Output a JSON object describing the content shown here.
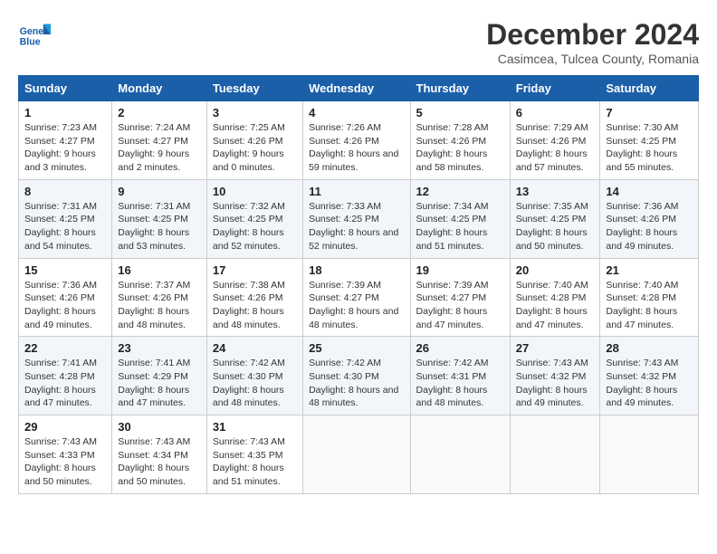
{
  "header": {
    "logo_line1": "General",
    "logo_line2": "Blue",
    "title": "December 2024",
    "subtitle": "Casimcea, Tulcea County, Romania"
  },
  "weekdays": [
    "Sunday",
    "Monday",
    "Tuesday",
    "Wednesday",
    "Thursday",
    "Friday",
    "Saturday"
  ],
  "weeks": [
    [
      {
        "day": "1",
        "sunrise": "Sunrise: 7:23 AM",
        "sunset": "Sunset: 4:27 PM",
        "daylight": "Daylight: 9 hours and 3 minutes."
      },
      {
        "day": "2",
        "sunrise": "Sunrise: 7:24 AM",
        "sunset": "Sunset: 4:27 PM",
        "daylight": "Daylight: 9 hours and 2 minutes."
      },
      {
        "day": "3",
        "sunrise": "Sunrise: 7:25 AM",
        "sunset": "Sunset: 4:26 PM",
        "daylight": "Daylight: 9 hours and 0 minutes."
      },
      {
        "day": "4",
        "sunrise": "Sunrise: 7:26 AM",
        "sunset": "Sunset: 4:26 PM",
        "daylight": "Daylight: 8 hours and 59 minutes."
      },
      {
        "day": "5",
        "sunrise": "Sunrise: 7:28 AM",
        "sunset": "Sunset: 4:26 PM",
        "daylight": "Daylight: 8 hours and 58 minutes."
      },
      {
        "day": "6",
        "sunrise": "Sunrise: 7:29 AM",
        "sunset": "Sunset: 4:26 PM",
        "daylight": "Daylight: 8 hours and 57 minutes."
      },
      {
        "day": "7",
        "sunrise": "Sunrise: 7:30 AM",
        "sunset": "Sunset: 4:25 PM",
        "daylight": "Daylight: 8 hours and 55 minutes."
      }
    ],
    [
      {
        "day": "8",
        "sunrise": "Sunrise: 7:31 AM",
        "sunset": "Sunset: 4:25 PM",
        "daylight": "Daylight: 8 hours and 54 minutes."
      },
      {
        "day": "9",
        "sunrise": "Sunrise: 7:31 AM",
        "sunset": "Sunset: 4:25 PM",
        "daylight": "Daylight: 8 hours and 53 minutes."
      },
      {
        "day": "10",
        "sunrise": "Sunrise: 7:32 AM",
        "sunset": "Sunset: 4:25 PM",
        "daylight": "Daylight: 8 hours and 52 minutes."
      },
      {
        "day": "11",
        "sunrise": "Sunrise: 7:33 AM",
        "sunset": "Sunset: 4:25 PM",
        "daylight": "Daylight: 8 hours and 52 minutes."
      },
      {
        "day": "12",
        "sunrise": "Sunrise: 7:34 AM",
        "sunset": "Sunset: 4:25 PM",
        "daylight": "Daylight: 8 hours and 51 minutes."
      },
      {
        "day": "13",
        "sunrise": "Sunrise: 7:35 AM",
        "sunset": "Sunset: 4:25 PM",
        "daylight": "Daylight: 8 hours and 50 minutes."
      },
      {
        "day": "14",
        "sunrise": "Sunrise: 7:36 AM",
        "sunset": "Sunset: 4:26 PM",
        "daylight": "Daylight: 8 hours and 49 minutes."
      }
    ],
    [
      {
        "day": "15",
        "sunrise": "Sunrise: 7:36 AM",
        "sunset": "Sunset: 4:26 PM",
        "daylight": "Daylight: 8 hours and 49 minutes."
      },
      {
        "day": "16",
        "sunrise": "Sunrise: 7:37 AM",
        "sunset": "Sunset: 4:26 PM",
        "daylight": "Daylight: 8 hours and 48 minutes."
      },
      {
        "day": "17",
        "sunrise": "Sunrise: 7:38 AM",
        "sunset": "Sunset: 4:26 PM",
        "daylight": "Daylight: 8 hours and 48 minutes."
      },
      {
        "day": "18",
        "sunrise": "Sunrise: 7:39 AM",
        "sunset": "Sunset: 4:27 PM",
        "daylight": "Daylight: 8 hours and 48 minutes."
      },
      {
        "day": "19",
        "sunrise": "Sunrise: 7:39 AM",
        "sunset": "Sunset: 4:27 PM",
        "daylight": "Daylight: 8 hours and 47 minutes."
      },
      {
        "day": "20",
        "sunrise": "Sunrise: 7:40 AM",
        "sunset": "Sunset: 4:28 PM",
        "daylight": "Daylight: 8 hours and 47 minutes."
      },
      {
        "day": "21",
        "sunrise": "Sunrise: 7:40 AM",
        "sunset": "Sunset: 4:28 PM",
        "daylight": "Daylight: 8 hours and 47 minutes."
      }
    ],
    [
      {
        "day": "22",
        "sunrise": "Sunrise: 7:41 AM",
        "sunset": "Sunset: 4:28 PM",
        "daylight": "Daylight: 8 hours and 47 minutes."
      },
      {
        "day": "23",
        "sunrise": "Sunrise: 7:41 AM",
        "sunset": "Sunset: 4:29 PM",
        "daylight": "Daylight: 8 hours and 47 minutes."
      },
      {
        "day": "24",
        "sunrise": "Sunrise: 7:42 AM",
        "sunset": "Sunset: 4:30 PM",
        "daylight": "Daylight: 8 hours and 48 minutes."
      },
      {
        "day": "25",
        "sunrise": "Sunrise: 7:42 AM",
        "sunset": "Sunset: 4:30 PM",
        "daylight": "Daylight: 8 hours and 48 minutes."
      },
      {
        "day": "26",
        "sunrise": "Sunrise: 7:42 AM",
        "sunset": "Sunset: 4:31 PM",
        "daylight": "Daylight: 8 hours and 48 minutes."
      },
      {
        "day": "27",
        "sunrise": "Sunrise: 7:43 AM",
        "sunset": "Sunset: 4:32 PM",
        "daylight": "Daylight: 8 hours and 49 minutes."
      },
      {
        "day": "28",
        "sunrise": "Sunrise: 7:43 AM",
        "sunset": "Sunset: 4:32 PM",
        "daylight": "Daylight: 8 hours and 49 minutes."
      }
    ],
    [
      {
        "day": "29",
        "sunrise": "Sunrise: 7:43 AM",
        "sunset": "Sunset: 4:33 PM",
        "daylight": "Daylight: 8 hours and 50 minutes."
      },
      {
        "day": "30",
        "sunrise": "Sunrise: 7:43 AM",
        "sunset": "Sunset: 4:34 PM",
        "daylight": "Daylight: 8 hours and 50 minutes."
      },
      {
        "day": "31",
        "sunrise": "Sunrise: 7:43 AM",
        "sunset": "Sunset: 4:35 PM",
        "daylight": "Daylight: 8 hours and 51 minutes."
      },
      null,
      null,
      null,
      null
    ]
  ]
}
